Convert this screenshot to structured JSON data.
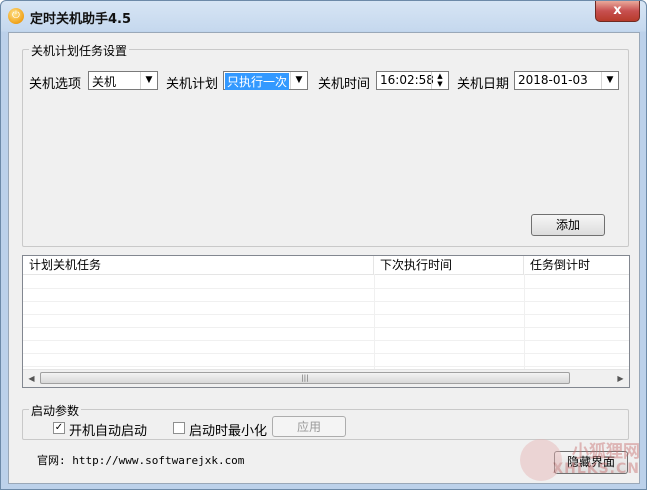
{
  "window": {
    "title": "定时关机助手4.5",
    "close_label": "x"
  },
  "schedule": {
    "group_title": "关机计划任务设置",
    "option_label": "关机选项",
    "option_value": "关机",
    "plan_label": "关机计划",
    "plan_value": "只执行一次",
    "time_label": "关机时间",
    "time_value": "16:02:58",
    "date_label": "关机日期",
    "date_value": "2018-01-03",
    "add_button": "添加"
  },
  "tasks": {
    "columns": [
      "计划关机任务",
      "下次执行时间",
      "任务倒计时"
    ],
    "rows": []
  },
  "startup": {
    "group_title": "启动参数",
    "auto_start_label": "开机自动启动",
    "auto_start_checked": true,
    "minimize_label": "启动时最小化",
    "minimize_checked": false,
    "apply_button": "应用"
  },
  "footer": {
    "website_label": "官网: http://www.softwarejxk.com",
    "hide_button": "隐藏界面"
  },
  "watermark": {
    "line1": "小狐狸网",
    "line2": "XHLKS.CN"
  },
  "icons": {
    "app": "power-icon",
    "dropdown": "chevron-down-icon"
  },
  "colors": {
    "selection": "#3399ff",
    "title_bar": "#c5d8ee",
    "close": "#c75050"
  }
}
